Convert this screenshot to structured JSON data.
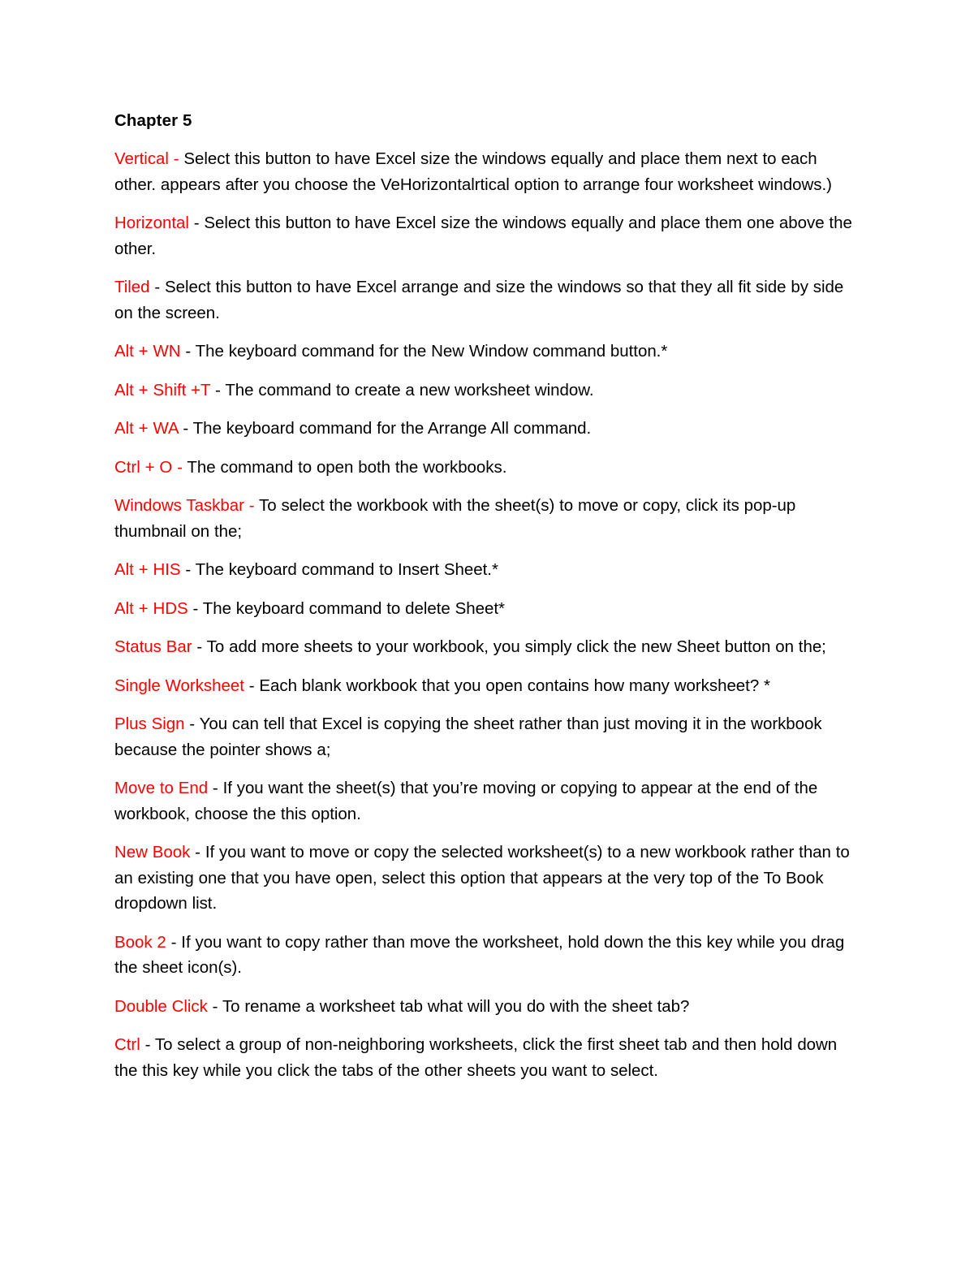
{
  "document": {
    "heading": "Chapter 5",
    "entries": [
      {
        "term": "Vertical",
        "separator": " - ",
        "separator_color": "#ff0000",
        "text": "Select this button to have Excel size the windows equally and place them next to each other. appears after you choose the VeHorizontalrtical option to arrange four worksheet windows.)"
      },
      {
        "term": "Horizontal",
        "separator": " - ",
        "separator_color": "#000000",
        "text": "Select this button to have Excel size the windows equally and place them one above the other."
      },
      {
        "term": "Tiled",
        "separator": " - ",
        "separator_color": "#000000",
        "text": "Select this button to have Excel arrange and size the windows so that they all fit side by side on the screen."
      },
      {
        "term": "Alt + WN",
        "separator": " - ",
        "separator_color": "#000000",
        "text": "The keyboard command for the New Window command button.*"
      },
      {
        "term": "Alt + Shift +T",
        "separator": " - ",
        "separator_color": "#000000",
        "text": "The command to create a new worksheet window."
      },
      {
        "term": "Alt + WA",
        "separator": " - ",
        "separator_color": "#000000",
        "text": "The keyboard command for the Arrange All command."
      },
      {
        "term": "Ctrl + O",
        "separator": " - ",
        "separator_color": "#ff0000",
        "text": "The command to open both the workbooks."
      },
      {
        "term": "Windows Taskbar",
        "separator": " - ",
        "separator_color": "#ff0000",
        "text": "To select the workbook with the sheet(s) to move or copy, click its pop-up thumbnail on the;"
      },
      {
        "term": "Alt + HIS",
        "separator": " - ",
        "separator_color": "#000000",
        "text": "The keyboard command to Insert Sheet.*"
      },
      {
        "term": "Alt + HDS",
        "separator": " - ",
        "separator_color": "#000000",
        "text": "The keyboard command to delete Sheet*"
      },
      {
        "term": "Status Bar",
        "separator": " - ",
        "separator_color": "#000000",
        "text": "To add more sheets to your workbook, you simply click the new Sheet button on the;"
      },
      {
        "term": "Single Worksheet",
        "separator": " - ",
        "separator_color": "#000000",
        "text": "Each blank workbook that you open contains how many worksheet? *"
      },
      {
        "term": "Plus Sign",
        "separator": " - ",
        "separator_color": "#000000",
        "text": "You can tell that Excel is copying the sheet rather than just moving it in the workbook because the pointer shows a;"
      },
      {
        "term": "Move to End",
        "separator": " - ",
        "separator_color": "#000000",
        "text": "If you want the sheet(s) that you’re moving or copying to appear at the end of the workbook, choose the this option."
      },
      {
        "term": "New Book",
        "separator": " - ",
        "separator_color": "#000000",
        "text": "If you want to move or copy the selected worksheet(s) to a new workbook rather than to an existing one that you have open, select this option that appears at the very top of the To Book dropdown list."
      },
      {
        "term": "Book 2",
        "separator": " - ",
        "separator_color": "#000000",
        "text": "If you want to copy rather than move the worksheet, hold down the this key while you drag the sheet icon(s)."
      },
      {
        "term": "Double Click",
        "separator": " - ",
        "separator_color": "#000000",
        "text": "To rename a worksheet tab what will you do with the sheet tab?"
      },
      {
        "term": "Ctrl",
        "separator": " - ",
        "separator_color": "#000000",
        "text": "To select a group of non-neighboring worksheets, click the first sheet tab and then hold down the this key while you click the tabs of the other sheets you want to select."
      }
    ]
  },
  "colors": {
    "term": "#ff0000",
    "body": "#000000",
    "background": "#ffffff"
  }
}
